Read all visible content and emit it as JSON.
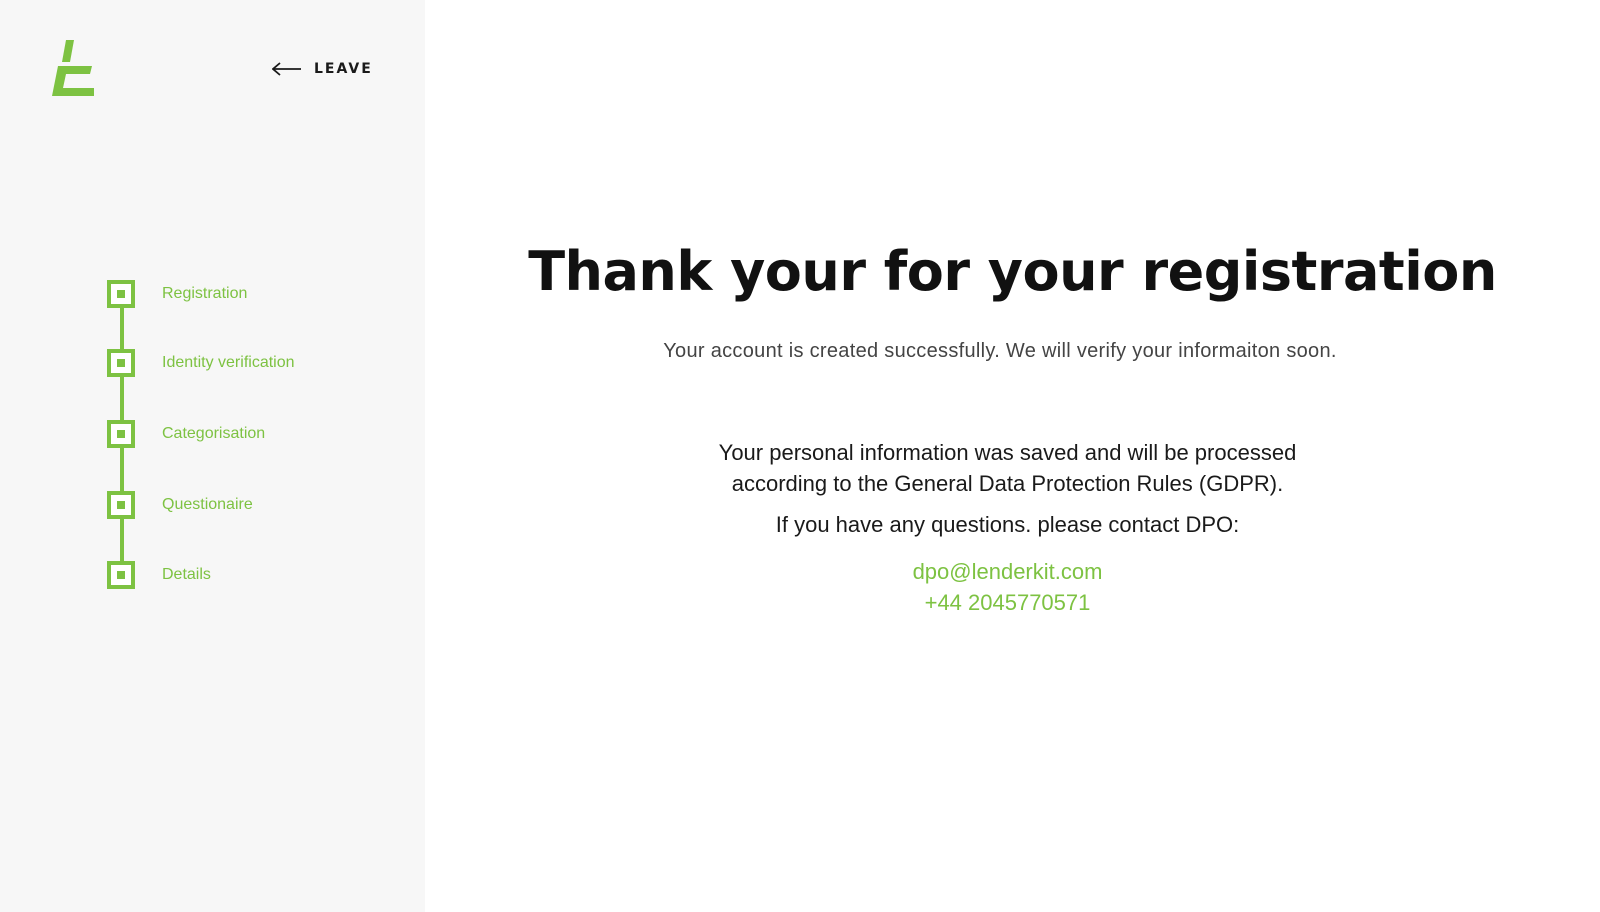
{
  "brand": {
    "logo_icon": "lenderkit-logo-icon",
    "accent_color": "#7dc242"
  },
  "header": {
    "leave_label": "LEAVE",
    "leave_icon": "arrow-left-icon"
  },
  "steps": [
    {
      "label": "Registration",
      "status": "completed"
    },
    {
      "label": "Identity verification",
      "status": "completed"
    },
    {
      "label": "Categorisation",
      "status": "completed"
    },
    {
      "label": "Questionaire",
      "status": "completed"
    },
    {
      "label": "Details",
      "status": "completed"
    }
  ],
  "main": {
    "title": "Thank your for your registration",
    "subtitle": "Your account is created successfully. We will verify your informaiton soon.",
    "gdpr_line1": "Your personal information was saved and will be processed",
    "gdpr_line2": "according to the General Data Protection Rules (GDPR).",
    "questions": "If you have any questions. please contact DPO:",
    "contact_email": "dpo@lenderkit.com",
    "contact_phone": "+44 2045770571"
  }
}
